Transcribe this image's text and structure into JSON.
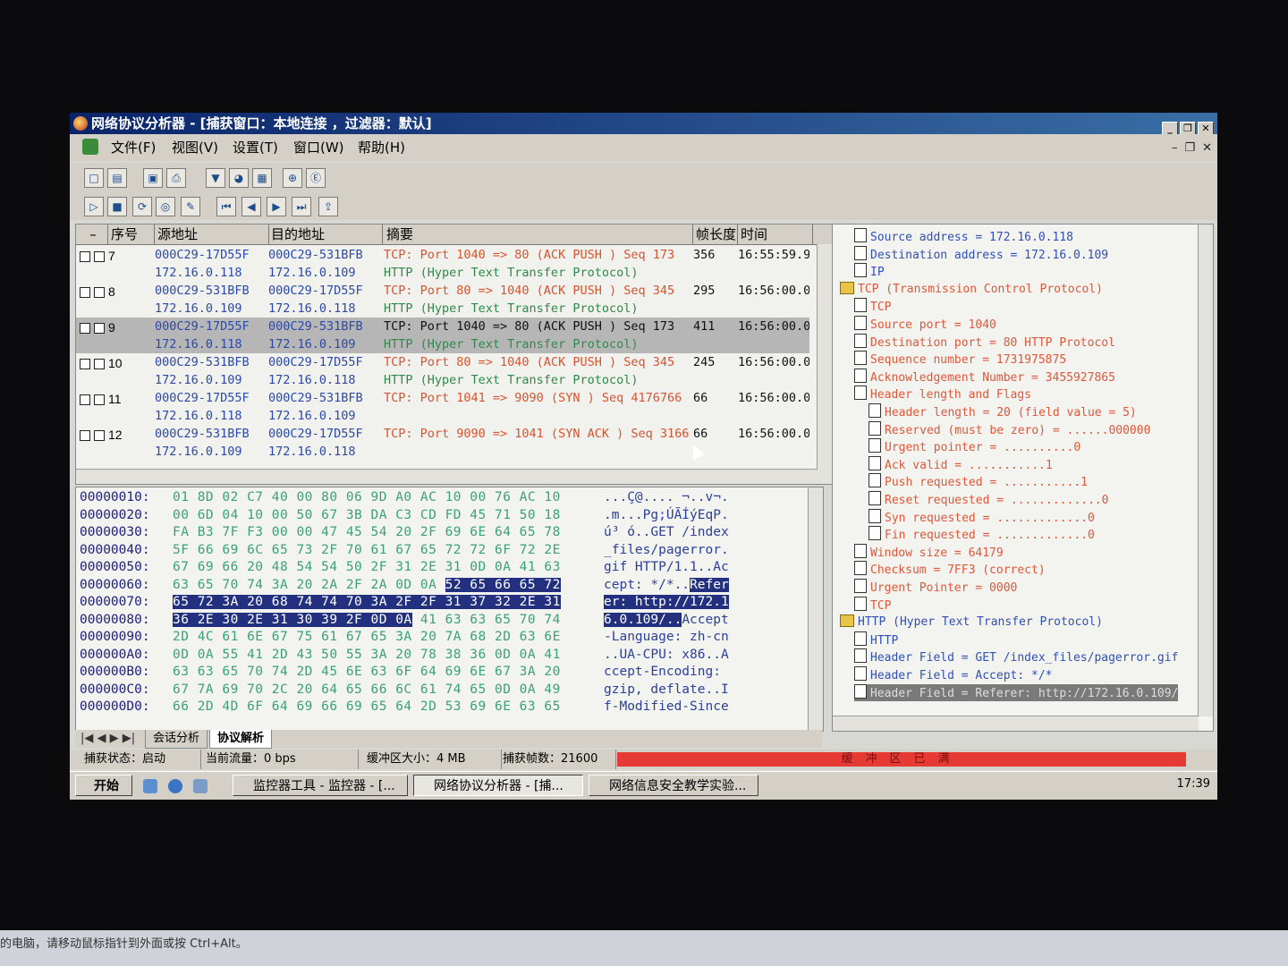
{
  "window": {
    "title": "网络协议分析器 - [捕获窗口：本地连接 ，过滤器：默认]"
  },
  "menu": [
    "文件(F)",
    "视图(V)",
    "设置(T)",
    "窗口(W)",
    "帮助(H)"
  ],
  "packet_list": {
    "columns": [
      "序号",
      "源地址",
      "目的地址",
      "摘要",
      "帧长度",
      "时间"
    ],
    "rows": [
      {
        "num": "7",
        "src_mac": "000C29-17D55F",
        "src_ip": "172.16.0.118",
        "dst_mac": "000C29-531BFB",
        "dst_ip": "172.16.0.109",
        "tcp": "TCP: Port 1040 => 80 (ACK PUSH ) Seq 173",
        "http": "HTTP (Hyper Text Transfer Protocol)",
        "len": "356",
        "time": "16:55:59.9"
      },
      {
        "num": "8",
        "src_mac": "000C29-531BFB",
        "src_ip": "172.16.0.109",
        "dst_mac": "000C29-17D55F",
        "dst_ip": "172.16.0.118",
        "tcp": "TCP: Port 80 => 1040 (ACK PUSH ) Seq 345",
        "http": "HTTP (Hyper Text Transfer Protocol)",
        "len": "295",
        "time": "16:56:00.0"
      },
      {
        "num": "9",
        "src_mac": "000C29-17D55F",
        "src_ip": "172.16.0.118",
        "dst_mac": "000C29-531BFB",
        "dst_ip": "172.16.0.109",
        "tcp": "TCP: Port 1040 => 80 (ACK PUSH ) Seq 173",
        "http": "HTTP (Hyper Text Transfer Protocol)",
        "len": "411",
        "time": "16:56:00.0"
      },
      {
        "num": "10",
        "src_mac": "000C29-531BFB",
        "src_ip": "172.16.0.109",
        "dst_mac": "000C29-17D55F",
        "dst_ip": "172.16.0.118",
        "tcp": "TCP: Port 80 => 1040 (ACK PUSH ) Seq 345",
        "http": "HTTP (Hyper Text Transfer Protocol)",
        "len": "245",
        "time": "16:56:00.0"
      },
      {
        "num": "11",
        "src_mac": "000C29-17D55F",
        "src_ip": "172.16.0.118",
        "dst_mac": "000C29-531BFB",
        "dst_ip": "172.16.0.109",
        "tcp": "TCP: Port 1041 => 9090 (SYN ) Seq 4176766",
        "http": "",
        "len": "66",
        "time": "16:56:00.0"
      },
      {
        "num": "12",
        "src_mac": "000C29-531BFB",
        "src_ip": "172.16.0.109",
        "dst_mac": "000C29-17D55F",
        "dst_ip": "172.16.0.118",
        "tcp": "TCP: Port 9090 => 1041 (SYN ACK ) Seq 3166",
        "http": "",
        "len": "66",
        "time": "16:56:00.0"
      }
    ],
    "selected_row": "9"
  },
  "hex_dump": [
    {
      "off": "00000010:",
      "bytes": "01 8D 02 C7 40 00 80 06 9D A0 AC 10 00 76 AC 10",
      "ascii": "...Ç@.... ¬..v¬."
    },
    {
      "off": "00000020:",
      "bytes": "00 6D 04 10 00 50 67 3B DA C3 CD FD 45 71 50 18",
      "ascii": ".m...Pg;ÚÃÍýEqP."
    },
    {
      "off": "00000030:",
      "bytes": "FA B3 7F F3 00 00 47 45 54 20 2F 69 6E 64 65 78",
      "ascii": "ú³ ó..GET /index"
    },
    {
      "off": "00000040:",
      "bytes": "5F 66 69 6C 65 73 2F 70 61 67 65 72 72 6F 72 2E",
      "ascii": "_files/pagerror."
    },
    {
      "off": "00000050:",
      "bytes": "67 69 66 20 48 54 54 50 2F 31 2E 31 0D 0A 41 63",
      "ascii": "gif HTTP/1.1..Ac"
    },
    {
      "off": "00000060:",
      "bytes_a": "63 65 70 74 3A 20 2A 2F 2A 0D 0A ",
      "bytes_b": "52 65 66 65 72",
      "ascii_a": "cept: */*..",
      "ascii_b": "Refer"
    },
    {
      "off": "00000070:",
      "bytes_b": "65 72 3A 20 68 74 74 70 3A 2F 2F 31 37 32 2E 31",
      "ascii_b": "er: http://172.1"
    },
    {
      "off": "00000080:",
      "bytes_b": "36 2E 30 2E 31 30 39 2F 0D 0A",
      "bytes_a": " 41 63 63 65 70 74",
      "ascii_b": "6.0.109/..",
      "ascii_a": "Accept"
    },
    {
      "off": "00000090:",
      "bytes": "2D 4C 61 6E 67 75 61 67 65 3A 20 7A 68 2D 63 6E",
      "ascii": "-Language: zh-cn"
    },
    {
      "off": "000000A0:",
      "bytes": "0D 0A 55 41 2D 43 50 55 3A 20 78 38 36 0D 0A 41",
      "ascii": "..UA-CPU: x86..A"
    },
    {
      "off": "000000B0:",
      "bytes": "63 63 65 70 74 2D 45 6E 63 6F 64 69 6E 67 3A 20",
      "ascii": "ccept-Encoding: "
    },
    {
      "off": "000000C0:",
      "bytes": "67 7A 69 70 2C 20 64 65 66 6C 61 74 65 0D 0A 49",
      "ascii": "gzip, deflate..I"
    },
    {
      "off": "000000D0:",
      "bytes": "66 2D 4D 6F 64 69 66 69 65 64 2D 53 69 6E 63 65",
      "ascii": "f-Modified-Since"
    }
  ],
  "tabs": [
    "会话分析",
    "协议解析"
  ],
  "tree": [
    {
      "indent": 2,
      "text": "Source address = 172.16.0.118",
      "red": false
    },
    {
      "indent": 2,
      "text": "Destination address = 172.16.0.109",
      "red": false
    },
    {
      "indent": 2,
      "text": "IP",
      "red": false
    },
    {
      "indent": 1,
      "text": "TCP (Transmission Control Protocol)",
      "red": true,
      "folder": true
    },
    {
      "indent": 2,
      "text": "TCP",
      "red": true
    },
    {
      "indent": 2,
      "text": "Source port = 1040",
      "red": true
    },
    {
      "indent": 2,
      "text": "Destination port = 80 HTTP Protocol",
      "red": true
    },
    {
      "indent": 2,
      "text": "Sequence number = 1731975875",
      "red": true
    },
    {
      "indent": 2,
      "text": "Acknowledgement Number = 3455927865",
      "red": true
    },
    {
      "indent": 2,
      "text": "Header length and Flags",
      "red": true
    },
    {
      "indent": 3,
      "text": "Header length = 20 (field value = 5)",
      "red": true
    },
    {
      "indent": 3,
      "text": "Reserved (must be zero) = ......000000",
      "red": true
    },
    {
      "indent": 3,
      "text": "Urgent pointer = ..........0",
      "red": true
    },
    {
      "indent": 3,
      "text": "Ack valid = ...........1",
      "red": true
    },
    {
      "indent": 3,
      "text": "Push requested = ...........1",
      "red": true
    },
    {
      "indent": 3,
      "text": "Reset requested = .............0",
      "red": true
    },
    {
      "indent": 3,
      "text": "Syn requested = .............0",
      "red": true
    },
    {
      "indent": 3,
      "text": "Fin requested = .............0",
      "red": true
    },
    {
      "indent": 2,
      "text": "Window size = 64179",
      "red": true
    },
    {
      "indent": 2,
      "text": "Checksum = 7FF3 (correct)",
      "red": true
    },
    {
      "indent": 2,
      "text": "Urgent Pointer = 0000",
      "red": true
    },
    {
      "indent": 2,
      "text": "TCP",
      "red": true
    },
    {
      "indent": 1,
      "text": "HTTP (Hyper Text Transfer Protocol)",
      "red": false,
      "folder": true
    },
    {
      "indent": 2,
      "text": "HTTP",
      "red": false
    },
    {
      "indent": 2,
      "text": "Header Field = GET /index_files/pagerror.gif",
      "red": false
    },
    {
      "indent": 2,
      "text": "Header Field = Accept: */*",
      "red": false
    },
    {
      "indent": 2,
      "text": "Header Field = Referer: http://172.16.0.109/",
      "red": false,
      "selected": true
    }
  ],
  "status": {
    "capture_state": "捕获状态：启动",
    "current_flow": "当前流量：0 bps",
    "buffer_size": "缓冲区大小：4 MB",
    "captured_frames": "捕获帧数：21600",
    "buffer_full": "缓冲区已满"
  },
  "taskbar": {
    "start": "开始",
    "items": [
      "监控器工具 - 监控器 - [...",
      "网络协议分析器 - [捕...",
      "网络信息安全教学实验..."
    ],
    "clock": "17:39"
  },
  "host_hint": "的电脑，请移动鼠标指针到外面或按 Ctrl+Alt。",
  "colors": {
    "title_start": "#0a246a",
    "title_end": "#3a6ea5",
    "ip_blue": "#2b49a8",
    "tcp_red": "#d9532c",
    "http_green": "#2f8a4a",
    "hex_highlight": "#22307f",
    "buffer_full_red": "#e63a35"
  }
}
